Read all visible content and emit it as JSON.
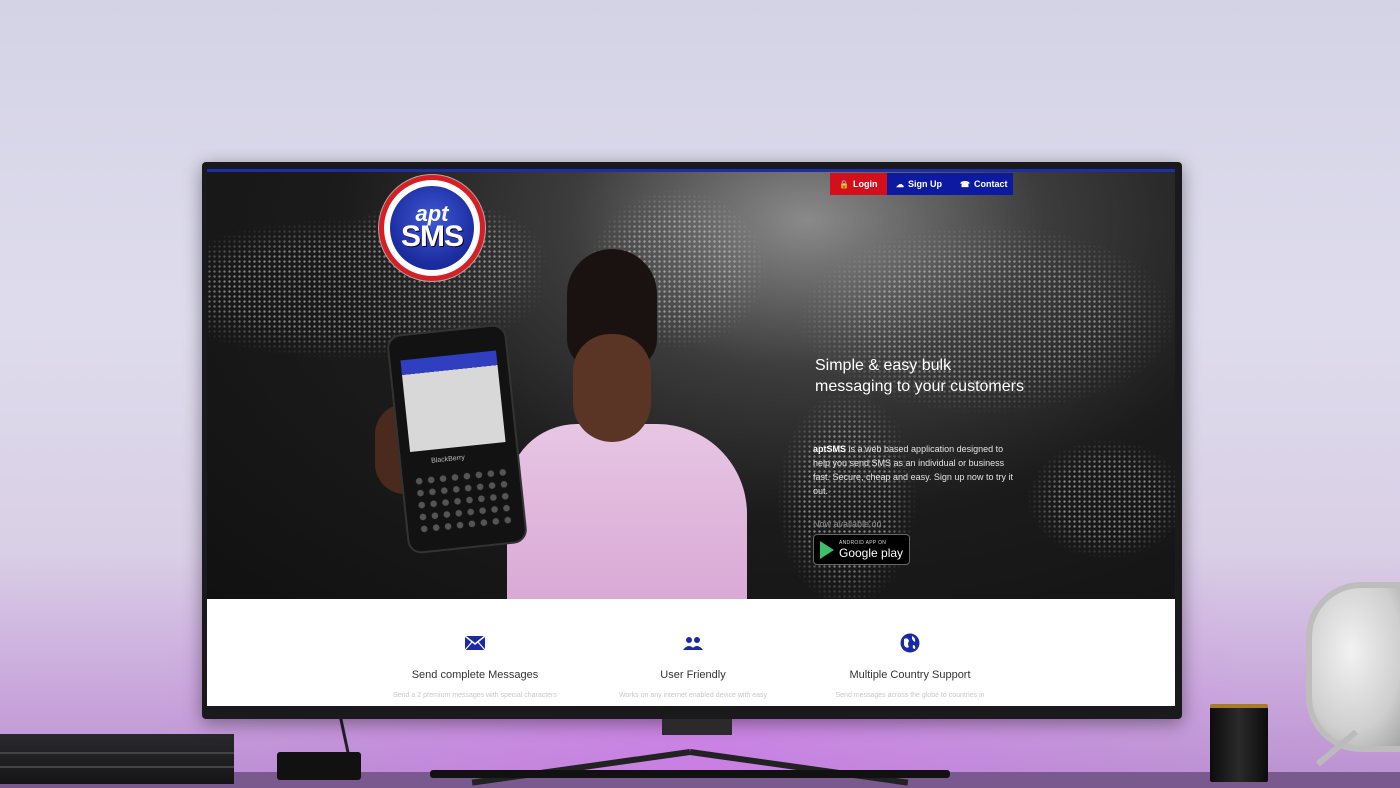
{
  "nav": {
    "login": "Login",
    "signup": "Sign Up",
    "contact": "Contact"
  },
  "logo": {
    "line1": "apt",
    "line2": "SMS"
  },
  "phone": {
    "brand": "BlackBerry"
  },
  "hero": {
    "title": "Simple & easy bulk messaging to your customers",
    "brand_bold": "aptSMS",
    "description": " is a web based application designed to help you send SMS as an individual or business fast. Secure, cheap and easy. Sign up now to try it out.",
    "available_label": "Now available on",
    "store_small": "ANDROID APP ON",
    "store_big": "Google play"
  },
  "features": [
    {
      "icon": "envelope-icon",
      "title": "Send complete Messages",
      "text": "Send a 2 premium messages with special characters"
    },
    {
      "icon": "users-icon",
      "title": "User Friendly",
      "text": "Works on any internet enabled device with easy"
    },
    {
      "icon": "globe-icon",
      "title": "Multiple Country Support",
      "text": "Send messages across the globe to countries in"
    }
  ],
  "colors": {
    "brand_blue": "#0b1aa0",
    "brand_red": "#d40f1c",
    "feature_icon": "#1a2aa6"
  }
}
